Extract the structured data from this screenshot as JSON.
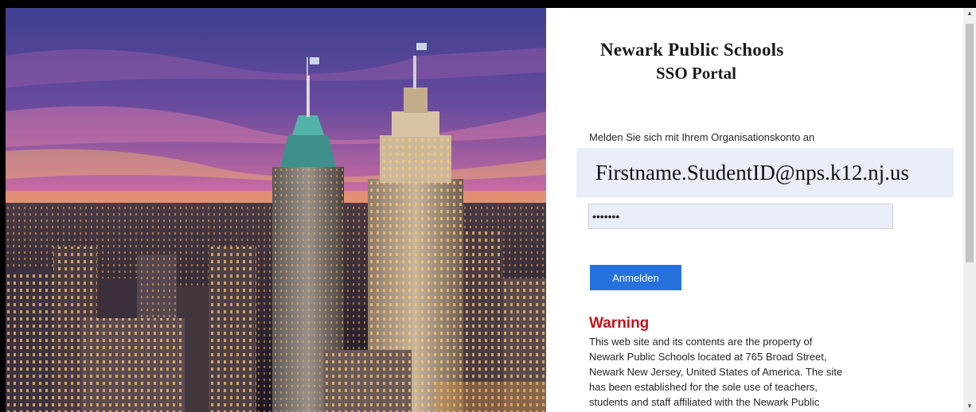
{
  "brand": {
    "line1": "Newark Public Schools",
    "line2": "SSO Portal"
  },
  "login": {
    "prompt": "Melden Sie sich mit Ihrem Organisationskonto an",
    "username_value": "Firstname.StudentID@nps.k12.nj.us",
    "password_value": "•••••••",
    "signin_label": "Anmelden"
  },
  "warning": {
    "title": "Warning",
    "lines": [
      "This web site and its contents are the property of",
      "Newark Public Schools located at 765 Broad Street,",
      "Newark New Jersey, United States of America. The site",
      "has been established for the sole use of teachers,",
      "students and staff affiliated with the Newark Public"
    ]
  },
  "scrollbar": {
    "up_icon": "arrow-up-icon",
    "down_icon": "arrow-down-icon"
  },
  "colors": {
    "accent_button": "#2672dc",
    "warning_red": "#c0141b",
    "field_bg": "#e9eef8"
  }
}
